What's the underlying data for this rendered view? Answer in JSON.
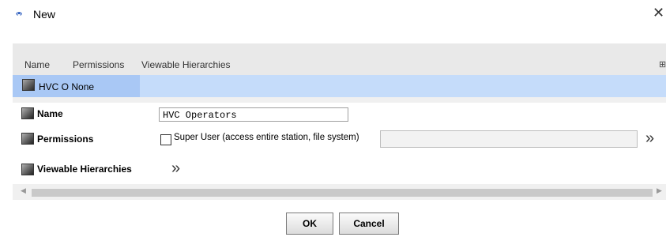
{
  "window": {
    "title": "New",
    "logo_glyph": "‹•›",
    "close_glyph": "✕"
  },
  "table": {
    "columns": [
      "Name",
      "Permissions",
      "Viewable Hierarchies"
    ],
    "columns_icon": "column-chooser-icon",
    "rows": [
      {
        "name": "HVC O",
        "permissions": "None",
        "viewable_hierarchies": ""
      }
    ]
  },
  "form": {
    "name_label": "Name",
    "name_value": "HVC Operators",
    "permissions_label": "Permissions",
    "super_user_label": "Super User (access entire station, file system)",
    "super_user_checked": false,
    "permissions_value": "",
    "viewable_label": "Viewable Hierarchies",
    "chevron_glyph": "»"
  },
  "buttons": {
    "ok": "OK",
    "cancel": "Cancel"
  },
  "colors": {
    "selection": "#c5dcfa",
    "selection_cell": "#a9c8f5",
    "logo": "#1a4fb8"
  }
}
